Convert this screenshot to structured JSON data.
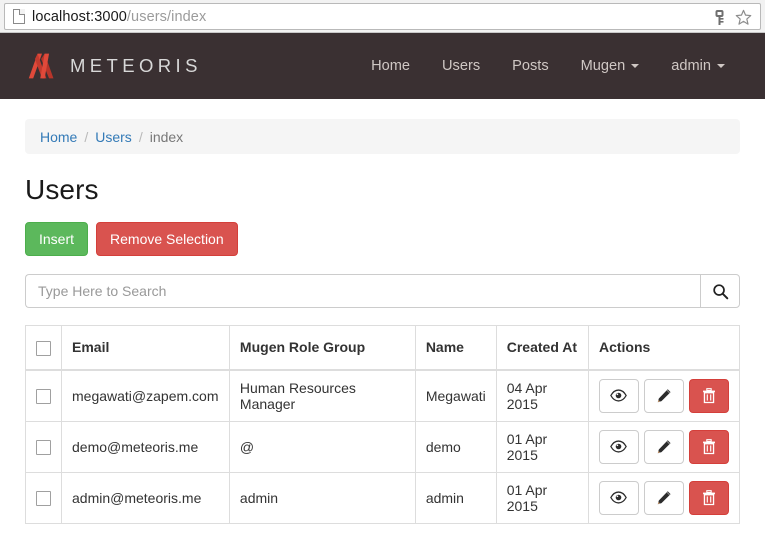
{
  "browser": {
    "url_host": "localhost:3000",
    "url_path": "/users/index",
    "page_icon": "page-icon",
    "key_icon": "key-icon",
    "star_icon": "star-icon"
  },
  "navbar": {
    "brand": "METEORIS",
    "brand_logo": "meteoris-m-logo",
    "brand_color": "#e04b3c",
    "background": "#3a3032",
    "links": [
      {
        "label": "Home",
        "dropdown": false
      },
      {
        "label": "Users",
        "dropdown": false
      },
      {
        "label": "Posts",
        "dropdown": false
      },
      {
        "label": "Mugen",
        "dropdown": true
      },
      {
        "label": "admin",
        "dropdown": true
      }
    ]
  },
  "breadcrumb": {
    "items": [
      {
        "label": "Home",
        "active": false
      },
      {
        "label": "Users",
        "active": false
      },
      {
        "label": "index",
        "active": true
      }
    ],
    "separator": "/"
  },
  "page": {
    "title": "Users"
  },
  "toolbar": {
    "insert_label": "Insert",
    "insert_color": "#5cb85c",
    "remove_label": "Remove Selection",
    "remove_color": "#d9534f"
  },
  "search": {
    "placeholder": "Type Here to Search",
    "value": "",
    "button_icon": "search-icon"
  },
  "table": {
    "columns": [
      "",
      "Email",
      "Mugen Role Group",
      "Name",
      "Created At",
      "Actions"
    ],
    "rows": [
      {
        "email": "megawati@zapem.com",
        "role_group": "Human Resources Manager",
        "name": "Megawati",
        "created_at": "04 Apr 2015",
        "checked": false
      },
      {
        "email": "demo@meteoris.me",
        "role_group": "@",
        "name": "demo",
        "created_at": "01 Apr 2015",
        "checked": false
      },
      {
        "email": "admin@meteoris.me",
        "role_group": "admin",
        "name": "admin",
        "created_at": "01 Apr 2015",
        "checked": false
      }
    ],
    "actions": [
      {
        "name": "view",
        "icon": "eye-icon"
      },
      {
        "name": "edit",
        "icon": "pencil-icon"
      },
      {
        "name": "delete",
        "icon": "trash-icon"
      }
    ]
  }
}
